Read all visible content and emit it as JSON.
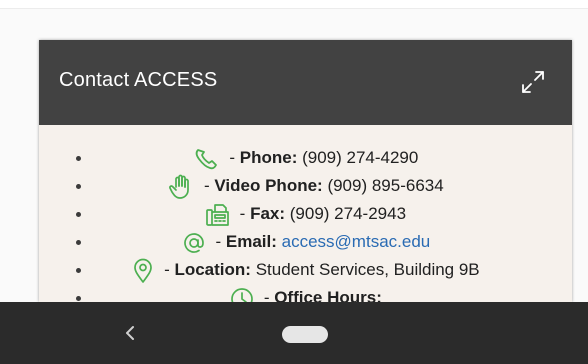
{
  "card": {
    "title": "Contact ACCESS",
    "expand_icon": "expand-arrows-icon"
  },
  "contacts": [
    {
      "icon": "phone-icon",
      "label": "Phone:",
      "value": "(909) 274-4290",
      "link": false
    },
    {
      "icon": "sign-language-hand-icon",
      "label": "Video Phone:",
      "value": "(909) 895-6634",
      "link": false
    },
    {
      "icon": "fax-icon",
      "label": "Fax:",
      "value": "(909) 274-2943",
      "link": false
    },
    {
      "icon": "at-sign-icon",
      "label": "Email:",
      "value": "access@mtsac.edu",
      "link": true
    },
    {
      "icon": "map-pin-icon",
      "label": "Location:",
      "value": "Student Services, Building 9B",
      "link": false
    },
    {
      "icon": "clock-icon",
      "label": "Office Hours:",
      "value": "",
      "link": false
    }
  ],
  "separator": " - ",
  "nav": {
    "back_icon": "back-chevron-icon",
    "home_icon": "home-pill"
  },
  "colors": {
    "header_bg": "#424242",
    "card_bg": "#f6f1ec",
    "icon_green": "#4caf50",
    "link_blue": "#2a6bb3",
    "nav_bg": "#2b2b2b"
  }
}
